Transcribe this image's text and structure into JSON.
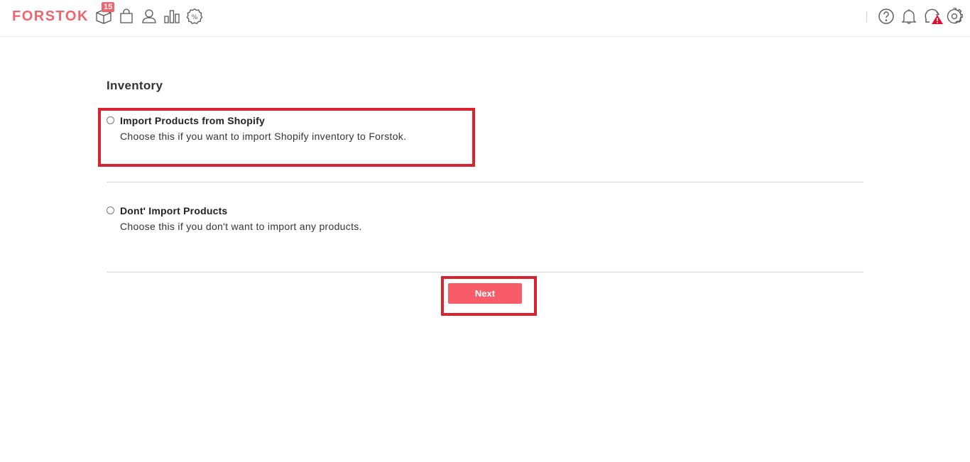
{
  "header": {
    "logo": "FORSTOK",
    "badge_count": "15",
    "left_icons": [
      "products-icon",
      "bag-icon",
      "user-icon",
      "chart-icon",
      "promo-icon"
    ],
    "right_icons": [
      "help-icon",
      "bell-icon",
      "sync-alert-icon",
      "gear-icon"
    ],
    "colors": {
      "brand": "#f0646e",
      "alert": "#e0102a"
    }
  },
  "main": {
    "title": "Inventory",
    "options": [
      {
        "title": "Import Products from Shopify",
        "description": "Choose this if you want to import Shopify inventory to Forstok.",
        "selected": false
      },
      {
        "title": "Dont' Import Products",
        "description": "Choose this if you don't want to import any products.",
        "selected": false
      }
    ],
    "next_label": "Next",
    "colors": {
      "button": "#f85c69",
      "highlight": "#d9232e"
    }
  }
}
